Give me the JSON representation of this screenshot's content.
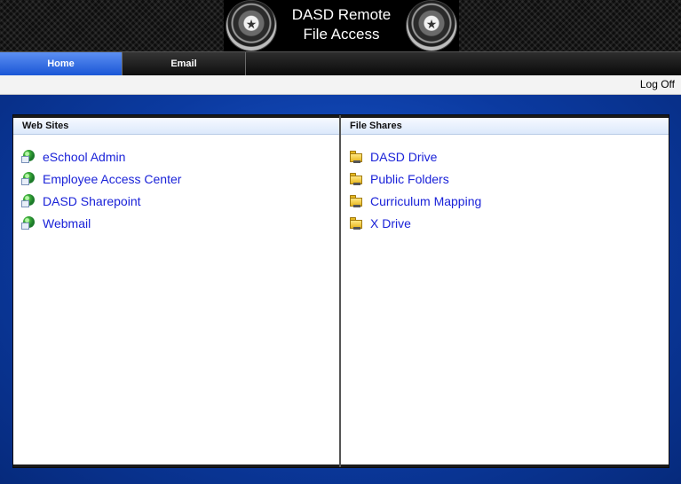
{
  "header": {
    "title_line1": "DASD Remote",
    "title_line2": "File Access"
  },
  "nav": {
    "tabs": [
      {
        "label": "Home",
        "active": true
      },
      {
        "label": "Email",
        "active": false
      }
    ]
  },
  "toolbar": {
    "logoff_label": "Log Off"
  },
  "panels": {
    "web_sites": {
      "title": "Web Sites",
      "icon": "globe-icon",
      "items": [
        {
          "label": "eSchool Admin"
        },
        {
          "label": "Employee Access Center"
        },
        {
          "label": "DASD Sharepoint"
        },
        {
          "label": "Webmail"
        }
      ]
    },
    "file_shares": {
      "title": "File Shares",
      "icon": "network-folder-icon",
      "items": [
        {
          "label": "DASD Drive"
        },
        {
          "label": "Public Folders"
        },
        {
          "label": "Curriculum Mapping"
        },
        {
          "label": "X Drive"
        }
      ]
    }
  },
  "colors": {
    "link": "#1a22d8",
    "active_tab": "#2a63dc",
    "background": "#0b3a9a"
  }
}
